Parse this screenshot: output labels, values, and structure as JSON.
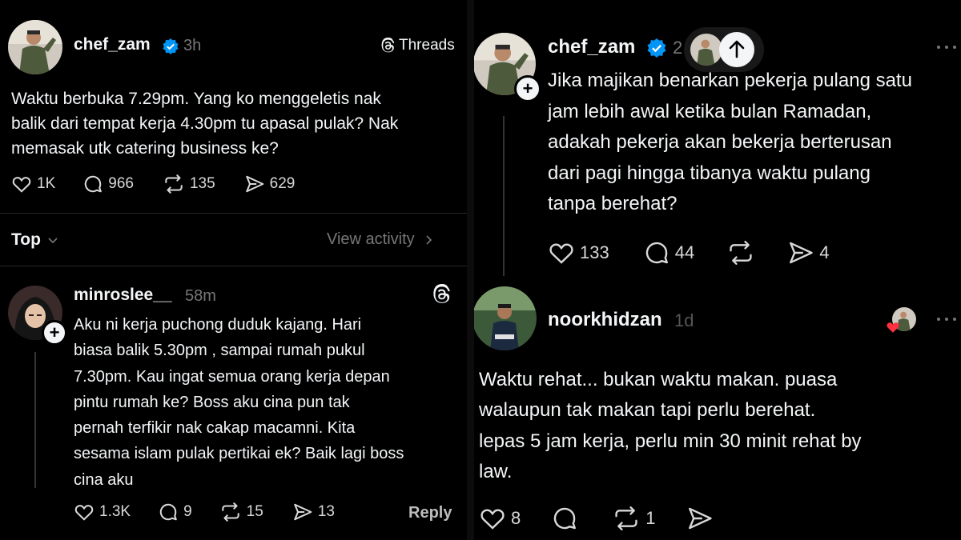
{
  "left": {
    "post": {
      "username": "chef_zam",
      "time": "3h",
      "brand": "Threads",
      "text_lines": [
        "Waktu berbuka 7.29pm.  Yang ko menggeletis nak",
        "balik dari tempat kerja 4.30pm tu apasal pulak?  Nak",
        "memasak utk catering business ke?"
      ],
      "likes": "1K",
      "replies": "966",
      "reposts": "135",
      "shares": "629"
    },
    "sort": {
      "label": "Top",
      "view_activity": "View activity"
    },
    "reply": {
      "username": "minroslee__",
      "time": "58m",
      "text_lines": [
        "Aku ni kerja puchong duduk kajang.  Hari",
        "biasa balik 5.30pm , sampai rumah pukul",
        "7.30pm. Kau ingat semua orang kerja depan",
        "pintu rumah ke? Boss aku cina pun tak",
        "pernah terfikir nak cakap macamni. Kita",
        "sesama islam pulak pertikai ek? Baik lagi boss",
        "cina aku"
      ],
      "likes": "1.3K",
      "replies": "9",
      "reposts": "15",
      "shares": "13",
      "reply_label": "Reply"
    }
  },
  "right": {
    "post": {
      "username": "chef_zam",
      "time": "2",
      "text_lines": [
        "Jika majikan benarkan pekerja pulang satu",
        "jam lebih awal ketika bulan Ramadan,",
        "adakah pekerja akan bekerja berterusan",
        "dari pagi hingga tibanya waktu pulang",
        "tanpa berehat?"
      ],
      "likes": "133",
      "replies": "44",
      "shares": "4"
    },
    "reply": {
      "username": "noorkhidzan",
      "time": "1d",
      "text_lines": [
        "Waktu rehat... bukan waktu makan. puasa",
        "walaupun tak makan tapi perlu berehat.",
        "lepas 5 jam kerja, perlu min 30 minit rehat by",
        "law."
      ],
      "likes": "8",
      "reposts": "1"
    }
  },
  "colors": {
    "background": "#000000",
    "text": "#f3f5f7",
    "muted": "#777777",
    "verified": "#0095f6",
    "like_heart": "#ff3040"
  }
}
